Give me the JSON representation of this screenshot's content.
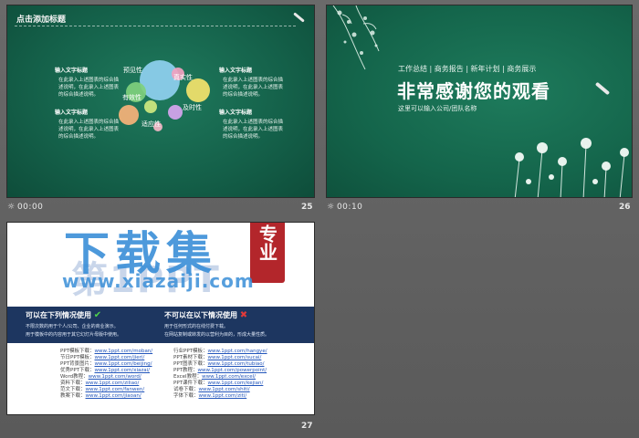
{
  "slides": [
    {
      "number": "25",
      "time": "00:00",
      "title": "点击添加标题",
      "blocks": [
        {
          "heading": "输入文字标题",
          "text": "在此录入上述图表的综合描述说明，在此录入上述图表的综合描述说明。"
        },
        {
          "heading": "输入文字标题",
          "text": "在此录入上述图表的综合描述说明，在此录入上述图表的综合描述说明。"
        },
        {
          "heading": "输入文字标题",
          "text": "在此录入上述图表的综合描述说明，在此录入上述图表的综合描述说明。"
        },
        {
          "heading": "输入文字标题",
          "text": "在此录入上述图表的综合描述说明，在此录入上述图表的综合描述说明。"
        }
      ],
      "bubbles": [
        "预见性",
        "真实性",
        "有效性",
        "及时性",
        "适应性"
      ]
    },
    {
      "number": "26",
      "time": "00:10",
      "tags": "工作总结 | 商务报告 | 新年计划 | 商务展示",
      "headline": "非常感谢您的观看",
      "subtitle": "这里可以输入公司/团队名称"
    },
    {
      "number": "27",
      "watermark_main": "下载集",
      "watermark_seal": "专业",
      "watermark_url": "www.xiazaiji.com",
      "can_use_title": "可以在下列情况使用",
      "can_use_lines": [
        "不限次数的用于个人/公司、企业的商业演示。",
        "用于模板中的内容用于其它幻灯片母版中使用。"
      ],
      "cannot_use_title": "不可以在以下情况使用",
      "cannot_use_lines": [
        "用于任何形式的在线付费下载。",
        "在网站复制或转发的以营利为目的，形成大量性质。"
      ],
      "links_left": [
        {
          "label": "PPT模板下载：",
          "url": "www.1ppt.com/moban/"
        },
        {
          "label": "节日PPT模板：",
          "url": "www.1ppt.com/jieri/"
        },
        {
          "label": "PPT背景图片：",
          "url": "www.1ppt.com/beijing/"
        },
        {
          "label": "优秀PPT下载：",
          "url": "www.1ppt.com/xiazai/"
        },
        {
          "label": "Word教程：",
          "url": "www.1ppt.com/word/"
        },
        {
          "label": "资料下载：",
          "url": "www.1ppt.com/ziliao/"
        },
        {
          "label": "范文下载：",
          "url": "www.1ppt.com/fanwen/"
        },
        {
          "label": "教案下载：",
          "url": "www.1ppt.com/jiaoan/"
        }
      ],
      "links_right": [
        {
          "label": "行业PPT模板：",
          "url": "www.1ppt.com/hangye/"
        },
        {
          "label": "PPT素材下载：",
          "url": "www.1ppt.com/sucai/"
        },
        {
          "label": "PPT图表下载：",
          "url": "www.1ppt.com/tubiao/"
        },
        {
          "label": "PPT教程：",
          "url": "www.1ppt.com/powerpoint/"
        },
        {
          "label": "Excel教程：",
          "url": "www.1ppt.com/excel/"
        },
        {
          "label": "PPT课件下载：",
          "url": "www.1ppt.com/kejian/"
        },
        {
          "label": "试卷下载：",
          "url": "www.1ppt.com/shiti/"
        },
        {
          "label": "字体下载：",
          "url": "www.1ppt.com/ziti/"
        }
      ]
    }
  ],
  "colors": {
    "chalkboard": "#146049",
    "navy_panel": "#1d3660",
    "watermark_blue": "#3a8fd8",
    "seal_red": "#b3262b"
  },
  "icons": {
    "transition": "transition-icon",
    "check": "check-icon",
    "cross": "cross-icon"
  }
}
